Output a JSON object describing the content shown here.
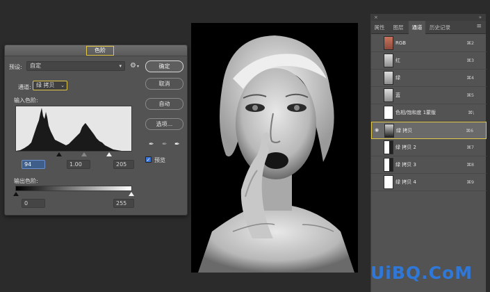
{
  "dialog": {
    "title": "色阶",
    "preset_label": "预设:",
    "preset_value": "自定",
    "channel_label": "通道:",
    "channel_value": "绿 拷贝",
    "input_levels_label": "输入色阶:",
    "input_values": [
      "94",
      "1.00",
      "205"
    ],
    "output_levels_label": "输出色阶:",
    "output_values": [
      "0",
      "255"
    ],
    "buttons": {
      "ok": "确定",
      "cancel": "取消",
      "auto": "自动",
      "options": "选项..."
    },
    "preview_label": "预览",
    "preview_checked": true,
    "input_slider_fractions": [
      0.369,
      0.5,
      0.804
    ],
    "output_slider_fractions": [
      0.0,
      1.0
    ]
  },
  "panel": {
    "tabs": [
      "属性",
      "图层",
      "通道",
      "历史记录"
    ],
    "active_tab": 2,
    "top_icons": [
      "collapse-icon",
      "close-icon"
    ],
    "channels": [
      {
        "name": "RGB",
        "shortcut": "⌘2",
        "thumb": "rgb",
        "eye": false,
        "active": false
      },
      {
        "name": "红",
        "shortcut": "⌘3",
        "thumb": "gray-light",
        "eye": false,
        "active": false
      },
      {
        "name": "绿",
        "shortcut": "⌘4",
        "thumb": "gray-light",
        "eye": false,
        "active": false
      },
      {
        "name": "蓝",
        "shortcut": "⌘5",
        "thumb": "gray-light",
        "eye": false,
        "active": false
      },
      {
        "name": "色相/饱和度 1蒙版",
        "shortcut": "⌘\\",
        "thumb": "white",
        "eye": false,
        "active": false
      },
      {
        "name": "绿 拷贝",
        "shortcut": "⌘6",
        "thumb": "dark",
        "eye": true,
        "active": true
      },
      {
        "name": "绿 拷贝 2",
        "shortcut": "⌘7",
        "thumb": "white-silhouette",
        "eye": false,
        "active": false
      },
      {
        "name": "绿 拷贝 3",
        "shortcut": "⌘8",
        "thumb": "white-silhouette",
        "eye": false,
        "active": false
      },
      {
        "name": "绿 拷贝 4",
        "shortcut": "⌘9",
        "thumb": "white",
        "eye": false,
        "active": false
      }
    ]
  },
  "watermark": "UiBQ.CoM",
  "colors": {
    "accent_yellow": "#e2c94b",
    "selection_blue": "#3a74d6",
    "watermark_blue": "#2f78d8",
    "panel_gray": "#535353"
  }
}
